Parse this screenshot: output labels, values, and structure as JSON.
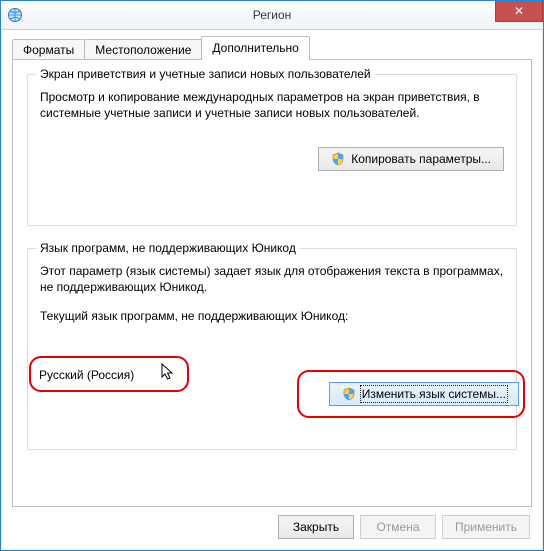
{
  "window": {
    "title": "Регион",
    "close_glyph": "✕"
  },
  "tabs": {
    "t0": "Форматы",
    "t1": "Местоположение",
    "t2": "Дополнительно"
  },
  "group_welcome": {
    "legend": "Экран приветствия и учетные записи новых пользователей",
    "desc": "Просмотр и копирование международных параметров на экран приветствия, в системные учетные записи и учетные записи новых пользователей.",
    "button": "Копировать параметры..."
  },
  "group_nonunicode": {
    "legend": "Язык программ, не поддерживающих Юникод",
    "desc": "Этот параметр (язык системы) задает язык для отображения текста в программах, не поддерживающих Юникод.",
    "current_label": "Текущий язык программ, не поддерживающих Юникод:",
    "current_value": "Русский (Россия)",
    "button": "Изменить язык системы..."
  },
  "buttons": {
    "close": "Закрыть",
    "cancel": "Отмена",
    "apply": "Применить"
  }
}
